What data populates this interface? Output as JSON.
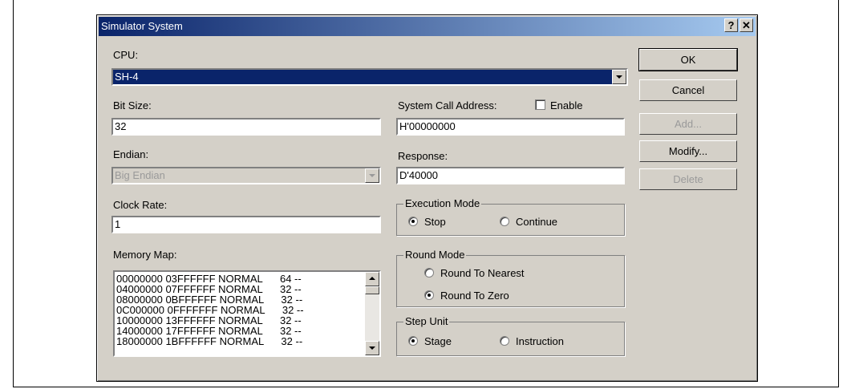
{
  "window": {
    "title": "Simulator System",
    "help_btn": "?",
    "close_btn": "✕"
  },
  "cpu": {
    "label": "CPU:",
    "value": "SH-4"
  },
  "bit_size": {
    "label": "Bit Size:",
    "value": "32"
  },
  "endian": {
    "label": "Endian:",
    "value": "Big Endian"
  },
  "clock_rate": {
    "label": "Clock Rate:",
    "value": "1"
  },
  "memory_map": {
    "label": "Memory Map:",
    "rows": [
      "00000000 03FFFFFF NORMAL      64 --",
      "04000000 07FFFFFF NORMAL      32 --",
      "08000000 0BFFFFFF NORMAL      32 --",
      "0C000000 0FFFFFFF NORMAL      32 --",
      "10000000 13FFFFFF NORMAL      32 --",
      "14000000 17FFFFFF NORMAL      32 --",
      "18000000 1BFFFFFF NORMAL      32 --"
    ]
  },
  "system_call": {
    "label": "System Call Address:",
    "enable_label": "Enable",
    "value": "H'00000000"
  },
  "response": {
    "label": "Response:",
    "value": "D'40000"
  },
  "execution_mode": {
    "label": "Execution Mode",
    "options": [
      "Stop",
      "Continue"
    ],
    "selected": "Stop"
  },
  "round_mode": {
    "label": "Round Mode",
    "options": [
      "Round To Nearest",
      "Round To Zero"
    ],
    "selected": "Round To Zero"
  },
  "step_unit": {
    "label": "Step Unit",
    "options": [
      "Stage",
      "Instruction"
    ],
    "selected": "Stage"
  },
  "buttons": {
    "ok": "OK",
    "cancel": "Cancel",
    "add": "Add...",
    "modify": "Modify...",
    "delete": "Delete"
  }
}
